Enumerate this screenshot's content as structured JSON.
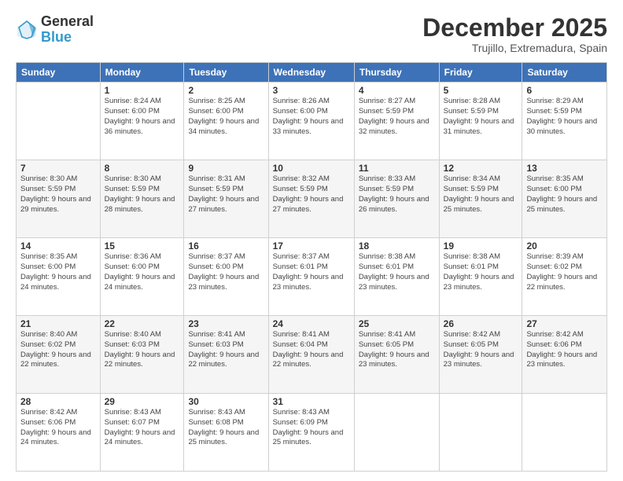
{
  "logo": {
    "general": "General",
    "blue": "Blue"
  },
  "header": {
    "month": "December 2025",
    "location": "Trujillo, Extremadura, Spain"
  },
  "days_of_week": [
    "Sunday",
    "Monday",
    "Tuesday",
    "Wednesday",
    "Thursday",
    "Friday",
    "Saturday"
  ],
  "weeks": [
    [
      {
        "day": "",
        "sunrise": "",
        "sunset": "",
        "daylight": ""
      },
      {
        "day": "1",
        "sunrise": "Sunrise: 8:24 AM",
        "sunset": "Sunset: 6:00 PM",
        "daylight": "Daylight: 9 hours and 36 minutes."
      },
      {
        "day": "2",
        "sunrise": "Sunrise: 8:25 AM",
        "sunset": "Sunset: 6:00 PM",
        "daylight": "Daylight: 9 hours and 34 minutes."
      },
      {
        "day": "3",
        "sunrise": "Sunrise: 8:26 AM",
        "sunset": "Sunset: 6:00 PM",
        "daylight": "Daylight: 9 hours and 33 minutes."
      },
      {
        "day": "4",
        "sunrise": "Sunrise: 8:27 AM",
        "sunset": "Sunset: 5:59 PM",
        "daylight": "Daylight: 9 hours and 32 minutes."
      },
      {
        "day": "5",
        "sunrise": "Sunrise: 8:28 AM",
        "sunset": "Sunset: 5:59 PM",
        "daylight": "Daylight: 9 hours and 31 minutes."
      },
      {
        "day": "6",
        "sunrise": "Sunrise: 8:29 AM",
        "sunset": "Sunset: 5:59 PM",
        "daylight": "Daylight: 9 hours and 30 minutes."
      }
    ],
    [
      {
        "day": "7",
        "sunrise": "Sunrise: 8:30 AM",
        "sunset": "Sunset: 5:59 PM",
        "daylight": "Daylight: 9 hours and 29 minutes."
      },
      {
        "day": "8",
        "sunrise": "Sunrise: 8:30 AM",
        "sunset": "Sunset: 5:59 PM",
        "daylight": "Daylight: 9 hours and 28 minutes."
      },
      {
        "day": "9",
        "sunrise": "Sunrise: 8:31 AM",
        "sunset": "Sunset: 5:59 PM",
        "daylight": "Daylight: 9 hours and 27 minutes."
      },
      {
        "day": "10",
        "sunrise": "Sunrise: 8:32 AM",
        "sunset": "Sunset: 5:59 PM",
        "daylight": "Daylight: 9 hours and 27 minutes."
      },
      {
        "day": "11",
        "sunrise": "Sunrise: 8:33 AM",
        "sunset": "Sunset: 5:59 PM",
        "daylight": "Daylight: 9 hours and 26 minutes."
      },
      {
        "day": "12",
        "sunrise": "Sunrise: 8:34 AM",
        "sunset": "Sunset: 5:59 PM",
        "daylight": "Daylight: 9 hours and 25 minutes."
      },
      {
        "day": "13",
        "sunrise": "Sunrise: 8:35 AM",
        "sunset": "Sunset: 6:00 PM",
        "daylight": "Daylight: 9 hours and 25 minutes."
      }
    ],
    [
      {
        "day": "14",
        "sunrise": "Sunrise: 8:35 AM",
        "sunset": "Sunset: 6:00 PM",
        "daylight": "Daylight: 9 hours and 24 minutes."
      },
      {
        "day": "15",
        "sunrise": "Sunrise: 8:36 AM",
        "sunset": "Sunset: 6:00 PM",
        "daylight": "Daylight: 9 hours and 24 minutes."
      },
      {
        "day": "16",
        "sunrise": "Sunrise: 8:37 AM",
        "sunset": "Sunset: 6:00 PM",
        "daylight": "Daylight: 9 hours and 23 minutes."
      },
      {
        "day": "17",
        "sunrise": "Sunrise: 8:37 AM",
        "sunset": "Sunset: 6:01 PM",
        "daylight": "Daylight: 9 hours and 23 minutes."
      },
      {
        "day": "18",
        "sunrise": "Sunrise: 8:38 AM",
        "sunset": "Sunset: 6:01 PM",
        "daylight": "Daylight: 9 hours and 23 minutes."
      },
      {
        "day": "19",
        "sunrise": "Sunrise: 8:38 AM",
        "sunset": "Sunset: 6:01 PM",
        "daylight": "Daylight: 9 hours and 23 minutes."
      },
      {
        "day": "20",
        "sunrise": "Sunrise: 8:39 AM",
        "sunset": "Sunset: 6:02 PM",
        "daylight": "Daylight: 9 hours and 22 minutes."
      }
    ],
    [
      {
        "day": "21",
        "sunrise": "Sunrise: 8:40 AM",
        "sunset": "Sunset: 6:02 PM",
        "daylight": "Daylight: 9 hours and 22 minutes."
      },
      {
        "day": "22",
        "sunrise": "Sunrise: 8:40 AM",
        "sunset": "Sunset: 6:03 PM",
        "daylight": "Daylight: 9 hours and 22 minutes."
      },
      {
        "day": "23",
        "sunrise": "Sunrise: 8:41 AM",
        "sunset": "Sunset: 6:03 PM",
        "daylight": "Daylight: 9 hours and 22 minutes."
      },
      {
        "day": "24",
        "sunrise": "Sunrise: 8:41 AM",
        "sunset": "Sunset: 6:04 PM",
        "daylight": "Daylight: 9 hours and 22 minutes."
      },
      {
        "day": "25",
        "sunrise": "Sunrise: 8:41 AM",
        "sunset": "Sunset: 6:05 PM",
        "daylight": "Daylight: 9 hours and 23 minutes."
      },
      {
        "day": "26",
        "sunrise": "Sunrise: 8:42 AM",
        "sunset": "Sunset: 6:05 PM",
        "daylight": "Daylight: 9 hours and 23 minutes."
      },
      {
        "day": "27",
        "sunrise": "Sunrise: 8:42 AM",
        "sunset": "Sunset: 6:06 PM",
        "daylight": "Daylight: 9 hours and 23 minutes."
      }
    ],
    [
      {
        "day": "28",
        "sunrise": "Sunrise: 8:42 AM",
        "sunset": "Sunset: 6:06 PM",
        "daylight": "Daylight: 9 hours and 24 minutes."
      },
      {
        "day": "29",
        "sunrise": "Sunrise: 8:43 AM",
        "sunset": "Sunset: 6:07 PM",
        "daylight": "Daylight: 9 hours and 24 minutes."
      },
      {
        "day": "30",
        "sunrise": "Sunrise: 8:43 AM",
        "sunset": "Sunset: 6:08 PM",
        "daylight": "Daylight: 9 hours and 25 minutes."
      },
      {
        "day": "31",
        "sunrise": "Sunrise: 8:43 AM",
        "sunset": "Sunset: 6:09 PM",
        "daylight": "Daylight: 9 hours and 25 minutes."
      },
      {
        "day": "",
        "sunrise": "",
        "sunset": "",
        "daylight": ""
      },
      {
        "day": "",
        "sunrise": "",
        "sunset": "",
        "daylight": ""
      },
      {
        "day": "",
        "sunrise": "",
        "sunset": "",
        "daylight": ""
      }
    ]
  ]
}
